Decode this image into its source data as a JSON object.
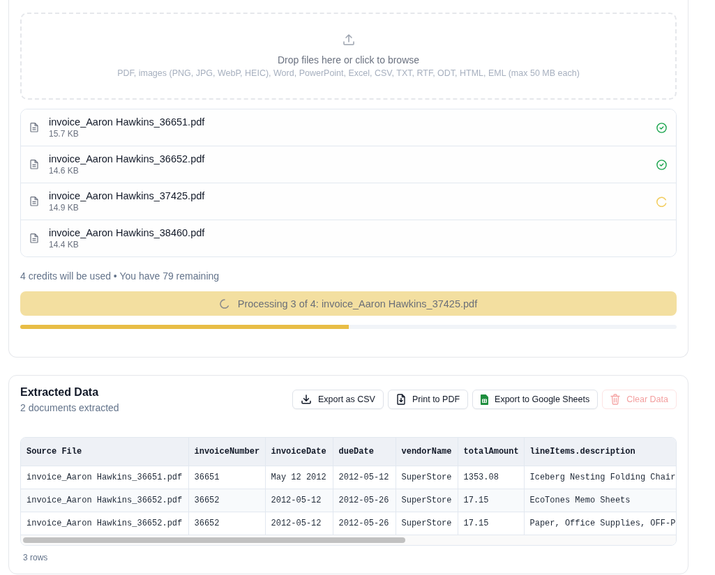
{
  "upload": {
    "title": "Drop files here or click to browse",
    "hint": "PDF, images (PNG, JPG, WebP, HEIC), Word, PowerPoint, Excel, CSV, TXT, RTF, ODT, HTML, EML (max 50 MB each)"
  },
  "files": [
    {
      "name": "invoice_Aaron Hawkins_36651.pdf",
      "size": "15.7 KB",
      "done": true,
      "processing": false
    },
    {
      "name": "invoice_Aaron Hawkins_36652.pdf",
      "size": "14.6 KB",
      "done": true,
      "processing": false
    },
    {
      "name": "invoice_Aaron Hawkins_37425.pdf",
      "size": "14.9 KB",
      "done": false,
      "processing": true
    },
    {
      "name": "invoice_Aaron Hawkins_38460.pdf",
      "size": "14.4 KB",
      "done": false,
      "processing": false
    }
  ],
  "credits": "4 credits will be used • You have 79 remaining",
  "processing": {
    "message": "Processing 3 of 4: invoice_Aaron Hawkins_37425.pdf",
    "level": 0.5
  },
  "extracted": {
    "title": "Extracted Data",
    "subtitle": "2 documents extracted",
    "buttons": [
      {
        "label": "Export as CSV",
        "kind": "csv",
        "disabled": false
      },
      {
        "label": "Print to PDF",
        "kind": "pdf",
        "disabled": false
      },
      {
        "label": "Export to Google Sheets",
        "kind": "sheets",
        "disabled": false
      },
      {
        "label": "Clear Data",
        "kind": "clear",
        "disabled": true
      }
    ],
    "table": {
      "columns": [
        "Source File",
        "invoiceNumber",
        "invoiceDate",
        "dueDate",
        "vendorName",
        "totalAmount",
        "lineItems.description"
      ],
      "rows": [
        [
          "invoice_Aaron Hawkins_36651.pdf",
          "36651",
          "May 12 2012",
          "2012-05-12",
          "SuperStore",
          "1353.08",
          "Iceberg Nesting Folding Chair"
        ],
        [
          "invoice_Aaron Hawkins_36652.pdf",
          "36652",
          "2012-05-12",
          "2012-05-26",
          "SuperStore",
          "17.15",
          "EcoTones Memo Sheets"
        ],
        [
          "invoice_Aaron Hawkins_36652.pdf",
          "36652",
          "2012-05-12",
          "2012-05-26",
          "SuperStore",
          "17.15",
          "Paper, Office Supplies, OFF-P"
        ]
      ]
    },
    "row_count": "3 rows"
  }
}
